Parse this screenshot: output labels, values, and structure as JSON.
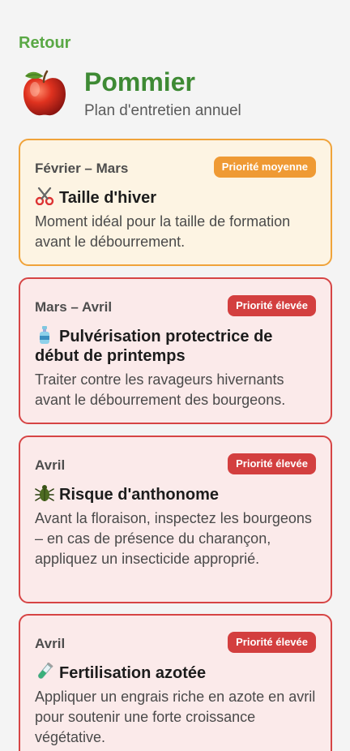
{
  "nav": {
    "back_label": "Retour"
  },
  "header": {
    "title": "Pommier",
    "subtitle": "Plan d'entretien annuel",
    "icon": "apple-icon"
  },
  "tasks": [
    {
      "period": "Février – Mars",
      "priority": "Priorité moyenne",
      "priority_level": "medium",
      "icon": "scissors-icon",
      "title": "Taille d'hiver",
      "description": "Moment idéal pour la taille de formation avant le débourrement."
    },
    {
      "period": "Mars – Avril",
      "priority": "Priorité élevée",
      "priority_level": "high",
      "icon": "spray-bottle-icon",
      "title": "Pulvérisation protectrice de début de printemps",
      "description": "Traiter contre les ravageurs hivernants avant le débourrement des bourgeons."
    },
    {
      "period": "Avril",
      "priority": "Priorité élevée",
      "priority_level": "high",
      "icon": "beetle-icon",
      "title": "Risque d'anthonome",
      "description": "Avant la floraison, inspectez les bourgeons – en cas de présence du charançon, appliquez un insecticide approprié."
    },
    {
      "period": "Avril",
      "priority": "Priorité élevée",
      "priority_level": "high",
      "icon": "test-tube-icon",
      "title": "Fertilisation azotée",
      "description": "Appliquer un engrais riche en azote en avril pour soutenir une forte croissance végétative."
    }
  ],
  "colors": {
    "accent_green": "#3e8a34",
    "back_green": "#5aa845",
    "medium_border": "#f0a33a",
    "medium_bg": "#fdf4e3",
    "high_border": "#d64545",
    "high_bg": "#fbeaea"
  }
}
